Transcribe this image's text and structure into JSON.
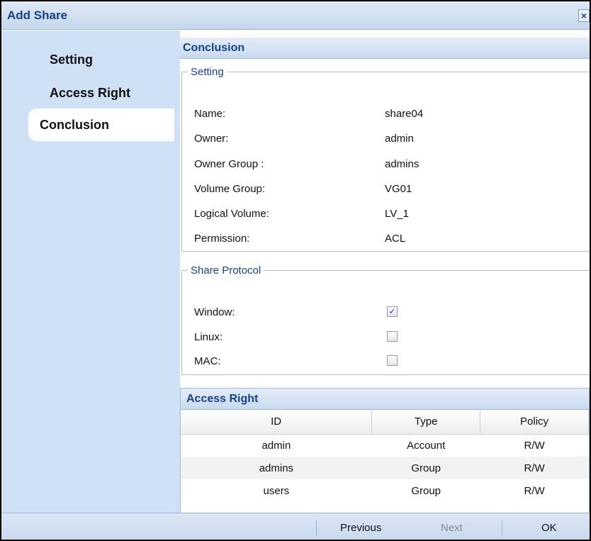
{
  "window": {
    "title": "Add Share",
    "close_glyph": "×"
  },
  "sidebar": {
    "items": [
      {
        "label": "Setting"
      },
      {
        "label": "Access Right"
      },
      {
        "label": "Conclusion",
        "active": true
      }
    ]
  },
  "main": {
    "header": "Conclusion",
    "setting": {
      "legend": "Setting",
      "rows": [
        {
          "label": "Name:",
          "value": "share04"
        },
        {
          "label": "Owner:",
          "value": "admin"
        },
        {
          "label": "Owner Group :",
          "value": "admins"
        },
        {
          "label": "Volume Group:",
          "value": "VG01"
        },
        {
          "label": "Logical Volume:",
          "value": "LV_1"
        },
        {
          "label": "Permission:",
          "value": "ACL"
        }
      ]
    },
    "share_protocol": {
      "legend": "Share Protocol",
      "items": [
        {
          "label": "Window:",
          "checked": true,
          "check_glyph": "✓"
        },
        {
          "label": "Linux:",
          "checked": false
        },
        {
          "label": "MAC:",
          "checked": false
        }
      ]
    },
    "access_right": {
      "header": "Access Right",
      "columns": [
        "ID",
        "Type",
        "Policy"
      ],
      "rows": [
        {
          "id": "admin",
          "type": "Account",
          "policy": "R/W"
        },
        {
          "id": "admins",
          "type": "Group",
          "policy": "R/W"
        },
        {
          "id": "users",
          "type": "Group",
          "policy": "R/W"
        }
      ]
    }
  },
  "footer": {
    "previous_label": "Previous",
    "next_label": "Next",
    "ok_label": "OK"
  },
  "colors": {
    "title_text": "#15428b",
    "sidebar_bg": "#d1e1f5",
    "header_bg": "#c9daee"
  },
  "icons": {
    "close": "close-icon",
    "checkbox_checked": "checkmark-icon"
  }
}
